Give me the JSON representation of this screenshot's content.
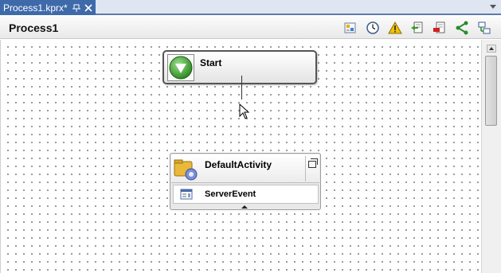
{
  "tab": {
    "title": "Process1.kprx*"
  },
  "header": {
    "title": "Process1"
  },
  "toolbar": {
    "buttons": [
      "properties-icon",
      "clock-icon",
      "warning-icon",
      "import-icon",
      "export-icon",
      "share-icon",
      "layout-icon"
    ]
  },
  "canvas": {
    "start_node": {
      "label": "Start"
    },
    "activity": {
      "label": "DefaultActivity",
      "event": {
        "label": "ServerEvent"
      }
    }
  },
  "colors": {
    "tab_active": "#3e6aaa",
    "start_green": "#3e9a2e",
    "warning_yellow": "#f2c200"
  }
}
